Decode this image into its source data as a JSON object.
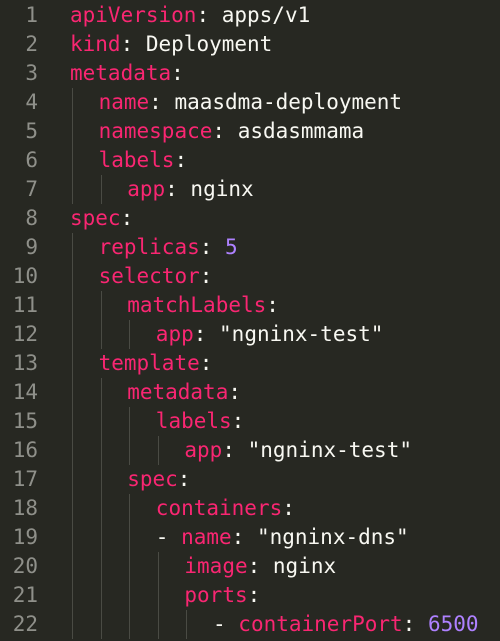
{
  "colors": {
    "background": "#272822",
    "line_number": "#8f908a",
    "key": "#f92672",
    "text": "#f8f8f2",
    "string": "#e6db74",
    "number": "#ae81ff",
    "indent_guide": "#4a4b44"
  },
  "lines": [
    {
      "number": "1",
      "key": "apiVersion",
      "colon": ":",
      "value": " apps/v1",
      "value_type": "plain"
    },
    {
      "number": "2",
      "key": "kind",
      "colon": ":",
      "value": " Deployment",
      "value_type": "plain"
    },
    {
      "number": "3",
      "key": "metadata",
      "colon": ":",
      "value": "",
      "value_type": "plain"
    },
    {
      "number": "4",
      "key": "name",
      "colon": ":",
      "value": " maasdma-deployment",
      "value_type": "plain"
    },
    {
      "number": "5",
      "key": "namespace",
      "colon": ":",
      "value": " asdasmmama",
      "value_type": "plain"
    },
    {
      "number": "6",
      "key": "labels",
      "colon": ":",
      "value": "",
      "value_type": "plain"
    },
    {
      "number": "7",
      "key": "app",
      "colon": ":",
      "value": " nginx",
      "value_type": "plain"
    },
    {
      "number": "8",
      "key": "spec",
      "colon": ":",
      "value": "",
      "value_type": "plain"
    },
    {
      "number": "9",
      "key": "replicas",
      "colon": ":",
      "value": " 5",
      "value_type": "number"
    },
    {
      "number": "10",
      "key": "selector",
      "colon": ":",
      "value": "",
      "value_type": "plain"
    },
    {
      "number": "11",
      "key": "matchLabels",
      "colon": ":",
      "value": "",
      "value_type": "plain"
    },
    {
      "number": "12",
      "key": "app",
      "colon": ":",
      "value": " \"ngninx-test\"",
      "value_type": "plain"
    },
    {
      "number": "13",
      "key": "template",
      "colon": ":",
      "value": "",
      "value_type": "plain"
    },
    {
      "number": "14",
      "key": "metadata",
      "colon": ":",
      "value": "",
      "value_type": "plain"
    },
    {
      "number": "15",
      "key": "labels",
      "colon": ":",
      "value": "",
      "value_type": "plain"
    },
    {
      "number": "16",
      "key": "app",
      "colon": ":",
      "value": " \"ngninx-test\"",
      "value_type": "plain"
    },
    {
      "number": "17",
      "key": "spec",
      "colon": ":",
      "value": "",
      "value_type": "plain"
    },
    {
      "number": "18",
      "key": "containers",
      "colon": ":",
      "value": "",
      "value_type": "plain"
    },
    {
      "number": "19",
      "key": "name",
      "colon": ":",
      "value": " \"ngninx-dns\"",
      "value_type": "plain",
      "prefix": "- "
    },
    {
      "number": "20",
      "key": "image",
      "colon": ":",
      "value": " nginx",
      "value_type": "plain"
    },
    {
      "number": "21",
      "key": "ports",
      "colon": ":",
      "value": "",
      "value_type": "plain"
    },
    {
      "number": "22",
      "key": "containerPort",
      "colon": ":",
      "value": " 6500",
      "value_type": "number",
      "prefix": "- "
    }
  ]
}
